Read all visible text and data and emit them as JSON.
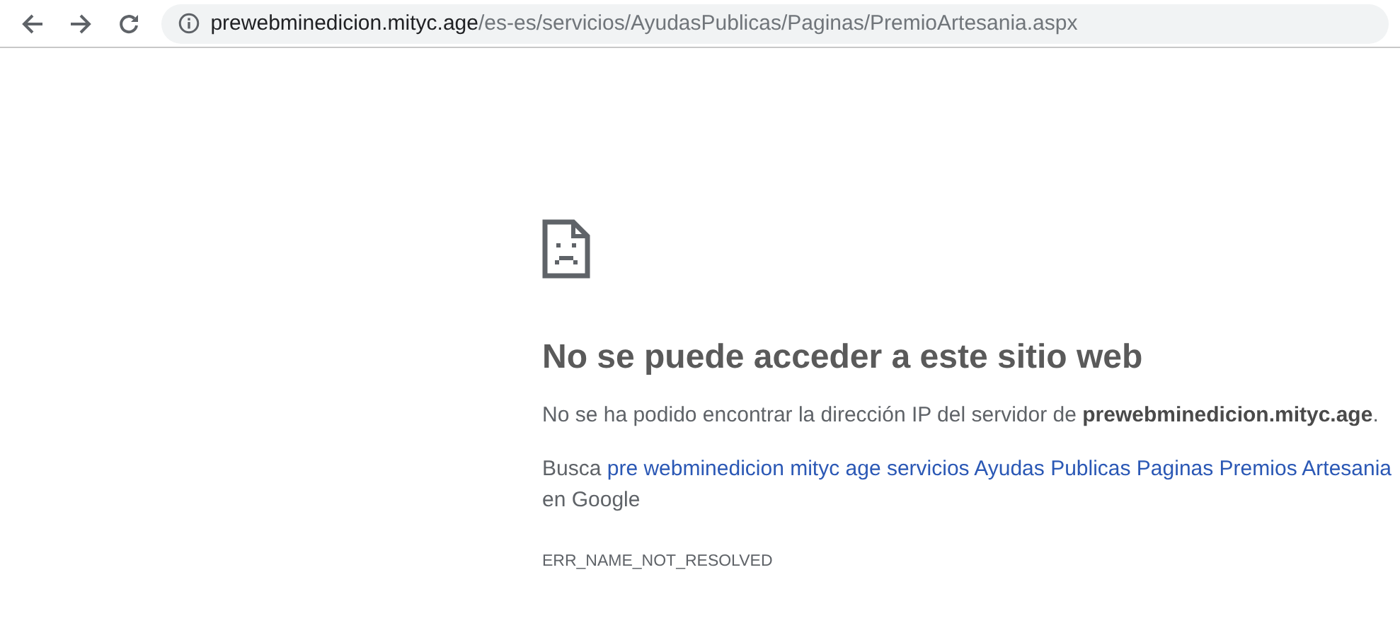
{
  "toolbar": {
    "url_host": "prewebminedicion.mityc.age",
    "url_path": "/es-es/servicios/AyudasPublicas/Paginas/PremioArtesania.aspx"
  },
  "error": {
    "title": "No se puede acceder a este sitio web",
    "description": "No se ha podido encontrar la dirección IP del servidor de **prewebminedicion.mityc.age**.",
    "search_prefix": "Busca ",
    "search_link": "pre webminedicion mityc age servicios Ayudas Publicas Paginas Premios Artesania",
    "search_suffix": " en Google",
    "code": "ERR_NAME_NOT_RESOLVED"
  }
}
